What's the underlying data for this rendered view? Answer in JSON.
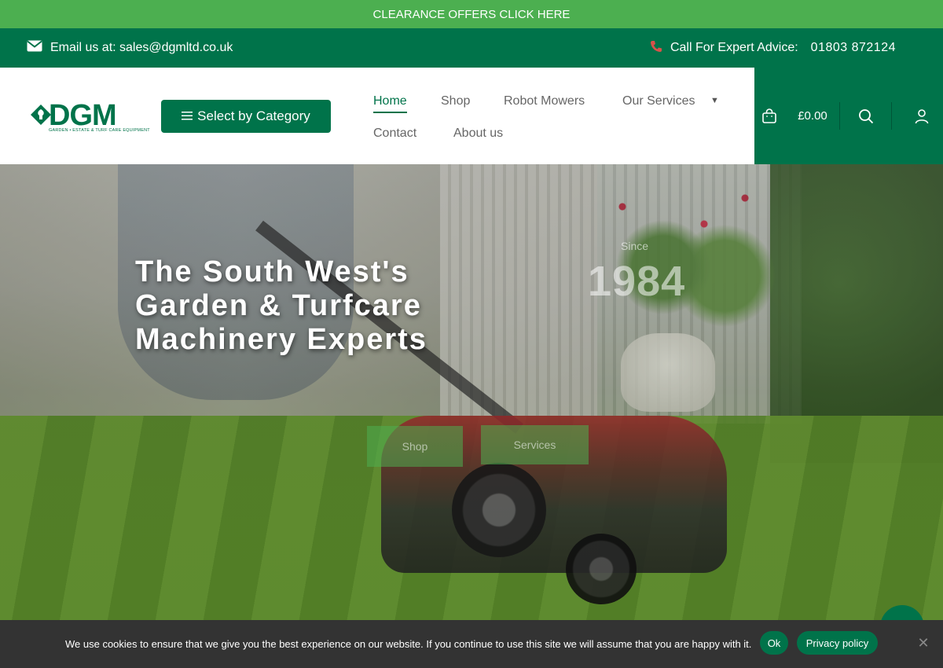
{
  "promo": {
    "text": "CLEARANCE OFFERS CLICK HERE"
  },
  "contact": {
    "email_text": "Email us at: sales@dgmltd.co.uk",
    "phone_label": "Call For Expert Advice:",
    "phone_number": "01803 872124",
    "icons": {
      "email": "envelope-icon",
      "phone": "phone-icon"
    }
  },
  "header": {
    "logo": {
      "text": "DGM",
      "subtitle": "GARDEN • ESTATE & TURF CARE EQUIPMENT"
    },
    "category_button": "Select by Category",
    "nav": {
      "home": "Home",
      "shop": "Shop",
      "robot_mowers": "Robot Mowers",
      "our_services": "Our Services",
      "contact": "Contact",
      "about": "About us"
    },
    "cart_total": "£0.00"
  },
  "hero": {
    "title_line1": "The South West's",
    "title_line2": "Garden & Turfcare",
    "title_line3": "Machinery Experts",
    "since_label": "Since",
    "since_year": "1984",
    "shop_button": "Shop",
    "services_button": "Services"
  },
  "cookie": {
    "message": "We use cookies to ensure that we give you the best experience on our website. If you continue to use this site we will assume that you are happy with it.",
    "ok_button": "Ok",
    "privacy_button": "Privacy policy"
  },
  "colors": {
    "brand_green": "#00734a",
    "promo_green": "#4caf50",
    "cookie_bg": "#333333"
  }
}
